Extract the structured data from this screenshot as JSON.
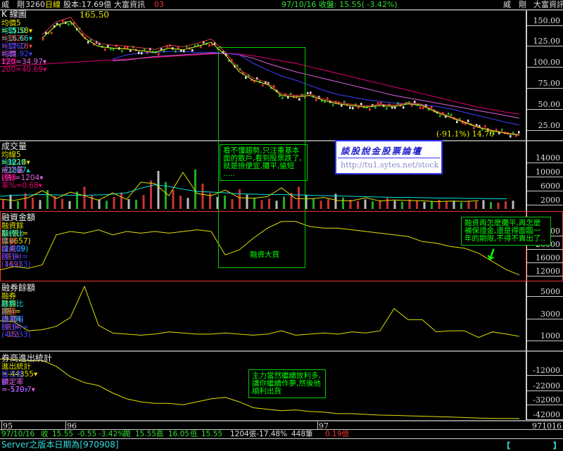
{
  "topbar": {
    "stock_name": "威　剛",
    "code": "3260",
    "period": "日線",
    "capital": "股本:17.69億",
    "source": "大富資訊",
    "market_code": "03",
    "date_close": "97/10/16 收盤: 15.55( -3.42%)",
    "right_name": "威　剛",
    "right_source": "大富資訊"
  },
  "price_panel": {
    "title": "K 線圖",
    "high_label": "165.50",
    "low_label": "(-91.1%) 14.70",
    "legend": [
      {
        "label": "均價5　=15.58▾",
        "color": "#e0e000"
      },
      {
        "label": "均價10 =16.66▾",
        "color": "#00e0e0"
      },
      {
        "label": "均價20 =17.18▾",
        "color": "#e04040"
      },
      {
        "label": "均價60 =24.92▾",
        "color": "#4040ff"
      },
      {
        "label": "均價120=34.97▾",
        "color": "#e060e0"
      },
      {
        "label": "均價200=40.69▾",
        "color": "#e00070"
      }
    ],
    "axis": [
      "150.00",
      "125.00",
      "100.00",
      "75.00",
      "50.00",
      "25.00"
    ]
  },
  "volume_panel": {
    "title": "成交量",
    "legend": [
      {
        "label": "均線5　=1218▾",
        "color": "#e0e000"
      },
      {
        "label": "均線20 =1887▴",
        "color": "#00e0e0"
      },
      {
        "label": "成交量(張)=1204▾",
        "color": "#e060e0"
      },
      {
        "label": "週轉率%=0.68▾",
        "color": "#e00070"
      }
    ],
    "axis": [
      "14000",
      "10000",
      "6000",
      "2000"
    ]
  },
  "margin_panel": {
    "title": "融資金額",
    "legend": [
      {
        "label": "融資餘額(張)=(10657)",
        "color": "#e0e000"
      },
      {
        "label": "融資比率=(24.09)",
        "color": "#00e0e0"
      },
      {
        "label": "餘額增減(張)=(169)",
        "color": "#e04040"
      },
      {
        "label": "融資限額(張)=(44233)",
        "color": "#4040ff"
      }
    ],
    "axis": [
      "24000",
      "20000",
      "16000",
      "12000"
    ]
  },
  "short_panel": {
    "title": "融券餘額",
    "legend": [
      {
        "label": "融券餘額(張)=(375)",
        "color": "#e0e000"
      },
      {
        "label": "融券比率=(0.84)",
        "color": "#00e0e0"
      },
      {
        "label": "餘額增減(張)=(-15)",
        "color": "#e04040"
      },
      {
        "label": "融券限額(張)=(44233)",
        "color": "#4040ff"
      }
    ],
    "axis": [
      "5000",
      "3000",
      "1000"
    ]
  },
  "broker_panel": {
    "title": "券商進出統計",
    "legend": [
      {
        "label": "進出統計=-44355▾",
        "color": "#e0e000"
      },
      {
        "label": "當日差額=-139▾",
        "color": "#4040ff"
      },
      {
        "label": "鎖定率=-570.7▾",
        "color": "#e060e0"
      }
    ],
    "axis": [
      "-12000",
      "-22000",
      "-32000",
      "-42000"
    ]
  },
  "notes": {
    "fundamental": "看不懂趨勢,只注重基本面的散戶,看到股票跌了,就是撿便宜,攤平,搶短 .....",
    "margin_buy": "融資大買",
    "margin_warning": "融資再怎麼攤平,再怎麼補保證金,還是得面臨一年的期限,不得不賣出了..",
    "main_force": "主力當然繼續放利多,讓你繼續作夢,然後他順利出貨"
  },
  "watermark": {
    "title": "談股說金股票論壇",
    "url": "http://tu1.sytes.net/stock"
  },
  "date_axis": {
    "labels": [
      "95",
      "96",
      "97"
    ],
    "end": "971016"
  },
  "status": {
    "date": "97/10/16",
    "close_label": "收",
    "close": "15.55",
    "change": "-0.55",
    "pct": "-3.42%",
    "open_label": "開",
    "open": "15.55",
    "high_label": "高",
    "high": "16.05",
    "low_label": "低",
    "low": "15.55",
    "volume": "1204張-17.48%",
    "trades": "448筆",
    "amount": "0.19億"
  },
  "server": {
    "text": "Server之版本日期為[970908]",
    "bracket_left": "【",
    "bracket_right": "】"
  },
  "chart_data": {
    "type": "line",
    "x_step": 20,
    "price": [
      null,
      null,
      null,
      130,
      145,
      150,
      130,
      120,
      118,
      117,
      115,
      113,
      118,
      116,
      120,
      125,
      110,
      90,
      80,
      75,
      62,
      60,
      62,
      56,
      52,
      50,
      48,
      50,
      49,
      52,
      50,
      42,
      36,
      30,
      24,
      20,
      17,
      15
    ],
    "ma60": [
      null,
      null,
      null,
      null,
      null,
      null,
      null,
      null,
      105,
      110,
      112,
      113,
      114,
      114,
      113,
      113,
      112,
      110,
      100,
      92,
      85,
      80,
      74,
      68,
      63,
      60,
      57,
      55,
      53,
      52,
      51,
      49,
      46,
      42,
      38,
      34,
      30,
      27
    ],
    "ma120": [
      null,
      null,
      null,
      null,
      null,
      null,
      null,
      null,
      103,
      104,
      106,
      108,
      109,
      110,
      111,
      112,
      112,
      110,
      106,
      100,
      95,
      90,
      86,
      82,
      78,
      74,
      70,
      66,
      62,
      59,
      56,
      53,
      50,
      47,
      44,
      41,
      38,
      35
    ],
    "ma200": [
      96,
      97,
      98,
      99,
      100,
      101,
      102,
      103,
      104,
      105,
      106,
      107,
      108,
      109,
      110,
      111,
      112,
      111,
      109,
      106,
      103,
      100,
      96,
      92,
      88,
      84,
      80,
      76,
      72,
      68,
      64,
      60,
      56,
      52,
      48,
      45,
      42,
      40
    ],
    "margin": [
      12500,
      13500,
      13000,
      14000,
      23000,
      24000,
      23500,
      24500,
      23000,
      24000,
      23500,
      24000,
      23500,
      24000,
      24500,
      24000,
      17000,
      18500,
      22000,
      25000,
      27000,
      27000,
      25500,
      25000,
      25000,
      24500,
      24000,
      23500,
      23000,
      22500,
      21000,
      20500,
      19500,
      19000,
      17500,
      15000,
      12500,
      11000
    ],
    "short": [
      2400,
      2300,
      1500,
      1600,
      1900,
      2700,
      5500,
      2000,
      1300,
      1200,
      1100,
      1200,
      1400,
      1300,
      1200,
      1200,
      1300,
      1200,
      1100,
      1200,
      1500,
      1100,
      1200,
      1300,
      1200,
      1400,
      1300,
      1500,
      3500,
      2500,
      2500,
      1400,
      1500,
      1500,
      900,
      1400,
      1200,
      1000
    ],
    "broker": [
      -4000,
      -4500,
      -5000,
      -5000,
      -9000,
      -16000,
      -20000,
      -22000,
      -27000,
      -31000,
      -33000,
      -34000,
      -34000,
      -35000,
      -33000,
      -31000,
      -30000,
      -33000,
      -37000,
      -38000,
      -39000,
      -38500,
      -39500,
      -40000,
      -41000,
      -41000,
      -41500,
      -42000,
      -42200,
      -42500,
      -42700,
      -43000,
      -43300,
      -43600,
      -44000,
      -44200,
      -44300,
      -44355
    ],
    "volume": [
      3000,
      4500,
      2500,
      5000,
      3500,
      2800,
      6000,
      4000,
      3200,
      2500,
      5500,
      7000,
      4200,
      3000,
      2600,
      3800,
      5200,
      3100,
      2900,
      4400,
      9000,
      12000,
      8500,
      6000,
      4200,
      3500,
      12500,
      8000,
      5000,
      3800,
      4200,
      3100,
      6200,
      4500,
      3500,
      2800,
      3300,
      2600,
      3900,
      5100,
      7000,
      4500,
      3200,
      2600,
      3100,
      4800,
      3600,
      2900,
      2500,
      3000,
      2400,
      2800,
      3500,
      2600,
      2300,
      3000,
      2700,
      2200,
      2500,
      2900,
      2400,
      2600,
      2100,
      2500,
      2300,
      2800,
      2200,
      2000,
      2400,
      2600
    ],
    "volume_ma20": [
      3200,
      3500,
      3600,
      3700,
      3600,
      3500,
      3500,
      3600,
      3800,
      4200,
      5500,
      6500,
      6000,
      5200,
      4600,
      4400,
      4200,
      3900,
      3800,
      3700,
      3700,
      3600,
      3500,
      3400,
      3300,
      3200,
      3100,
      3000,
      2900,
      2900,
      2800,
      2700,
      2700,
      2600,
      2600,
      2500,
      2500
    ]
  }
}
